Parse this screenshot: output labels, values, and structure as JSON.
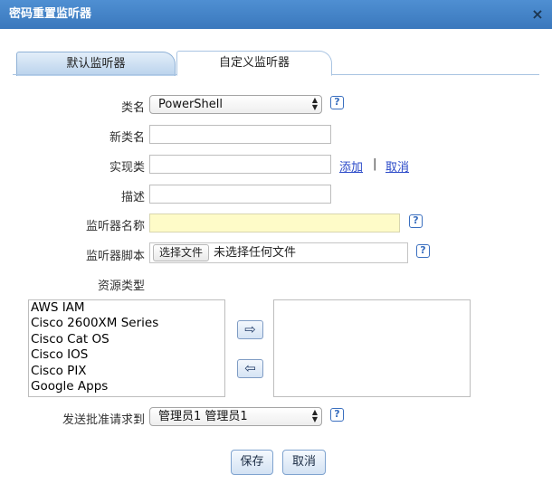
{
  "window": {
    "title": "密码重置监听器",
    "close_icon": "close-icon"
  },
  "tabs": [
    {
      "label": "默认监听器",
      "active": false
    },
    {
      "label": "自定义监听器",
      "active": true
    }
  ],
  "form": {
    "class_name": {
      "label": "类名",
      "colon": "：",
      "value": "PowerShell"
    },
    "new_class_name": {
      "label": "新类名",
      "colon": "：",
      "value": ""
    },
    "impl_class": {
      "label": "实现类",
      "colon": "：",
      "value": "",
      "add_link": "添加",
      "separator": "|",
      "cancel_link": "取消"
    },
    "description": {
      "label": "描述",
      "colon": "：",
      "value": ""
    },
    "listener_name": {
      "label": "监听器名称",
      "colon": "：",
      "value": ""
    },
    "listener_script": {
      "label": "监听器脚本",
      "colon": "：",
      "choose_button": "选择文件",
      "no_file_text": "未选择任何文件"
    },
    "resource_types": {
      "label": "资源类型",
      "colon": "：",
      "available": [
        "AWS IAM",
        "Cisco 2600XM Series",
        "Cisco Cat OS",
        "Cisco IOS",
        "Cisco PIX",
        "Google Apps"
      ],
      "selected": [],
      "move_right_icon": "arrow-right-icon",
      "move_left_icon": "arrow-left-icon",
      "move_right_glyph": "⇨",
      "move_left_glyph": "⇦"
    },
    "send_approval_to": {
      "label": "发送批准请求到",
      "colon": "：",
      "value": "管理员1 管理员1"
    }
  },
  "help_glyph": "?",
  "footer": {
    "save_label": "保存",
    "cancel_label": "取消"
  },
  "colors": {
    "titlebar": "#3a78bd",
    "link": "#2a49c8",
    "highlight_input": "#fefbc8"
  }
}
